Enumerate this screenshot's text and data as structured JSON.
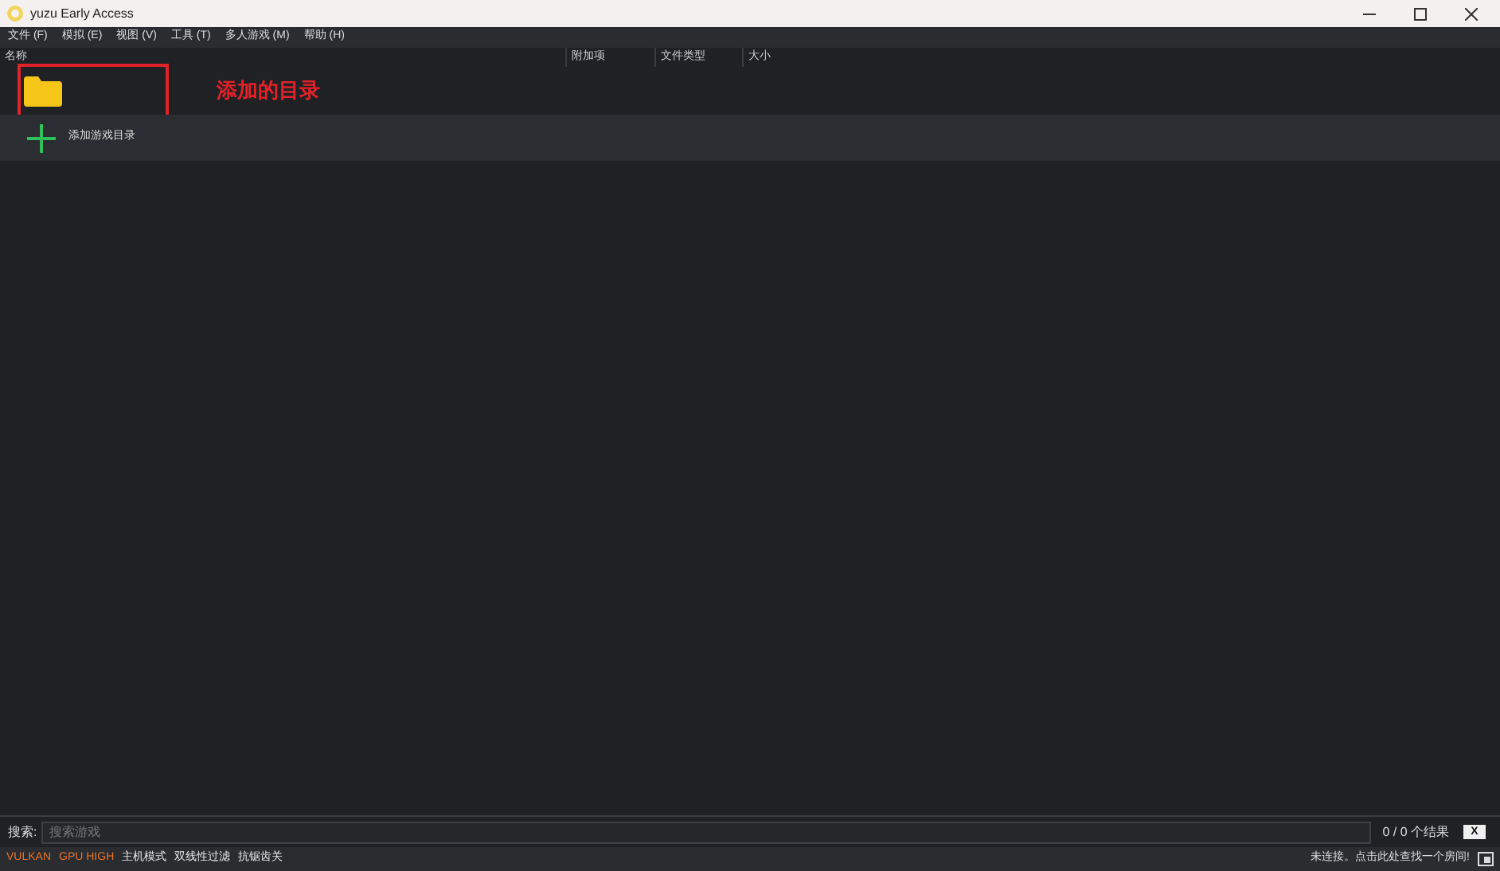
{
  "window": {
    "title": "yuzu Early Access"
  },
  "menu": [
    "文件 (F)",
    "模拟 (E)",
    "视图 (V)",
    "工具 (T)",
    "多人游戏 (M)",
    "帮助 (H)"
  ],
  "table": {
    "columns": [
      "名称",
      "附加项",
      "文件类型",
      "大小"
    ],
    "rows": [
      {
        "kind": "folder",
        "annotation": "添加的目录"
      },
      {
        "kind": "add",
        "label": "添加游戏目录"
      }
    ]
  },
  "search": {
    "label": "搜索:",
    "placeholder": "搜索游戏",
    "result": "0 / 0 个结果",
    "clear": "X"
  },
  "status_bar": {
    "left": [
      {
        "text": "VULKAN",
        "color": "#e8742a"
      },
      {
        "text": "GPU HIGH",
        "color": "#e8742a"
      },
      {
        "text": "主机模式",
        "color": "#e6e6e6"
      },
      {
        "text": "双线性过滤",
        "color": "#e6e6e6"
      },
      {
        "text": "抗锯齿关",
        "color": "#e6e6e6"
      }
    ],
    "right": "未连接。点击此处查找一个房间!"
  }
}
